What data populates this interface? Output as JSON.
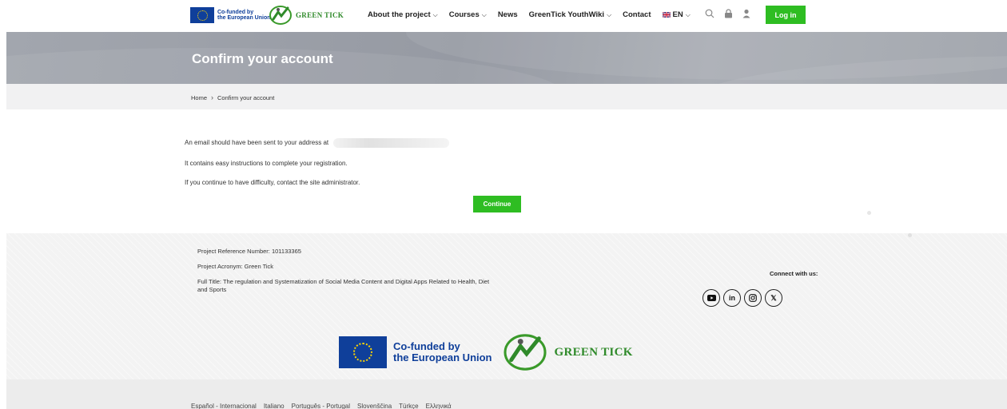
{
  "brand": {
    "eu_line1": "Co-funded by",
    "eu_line2": "the European Union",
    "name": "GREEN TICK"
  },
  "nav": {
    "items": [
      {
        "label": "About the project",
        "dropdown": true
      },
      {
        "label": "Courses",
        "dropdown": true
      },
      {
        "label": "News",
        "dropdown": false
      },
      {
        "label": "GreenTick YouthWiki",
        "dropdown": true
      },
      {
        "label": "Contact",
        "dropdown": false
      }
    ],
    "language": "EN",
    "login_label": "Log in"
  },
  "page": {
    "title": "Confirm your account"
  },
  "breadcrumb": {
    "home": "Home",
    "current": "Confirm your account"
  },
  "content": {
    "line1": "An email should have been sent to your address at",
    "line2": "It contains easy instructions to complete your registration.",
    "line3": "If you continue to have difficulty, contact the site administrator.",
    "continue_label": "Continue"
  },
  "footer": {
    "ref_number": "Project Reference Number: 101133365",
    "acronym": "Project Acronym: Green Tick",
    "full_title": "Full Title: The regulation and Systematization of Social Media Content and Digital Apps Related to Health, Diet and Sports",
    "connect": "Connect with us:",
    "socials": [
      "youtube-icon",
      "linkedin-icon",
      "instagram-icon",
      "x-icon"
    ],
    "languages": [
      "Español - Internacional",
      "Italiano",
      "Português - Portugal",
      "Slovenščina",
      "Türkçe",
      "Ελληνικά"
    ]
  },
  "colors": {
    "accent_green": "#2ebd22",
    "eu_blue": "#0f3f9a",
    "brand_green": "#2f8a2a"
  }
}
